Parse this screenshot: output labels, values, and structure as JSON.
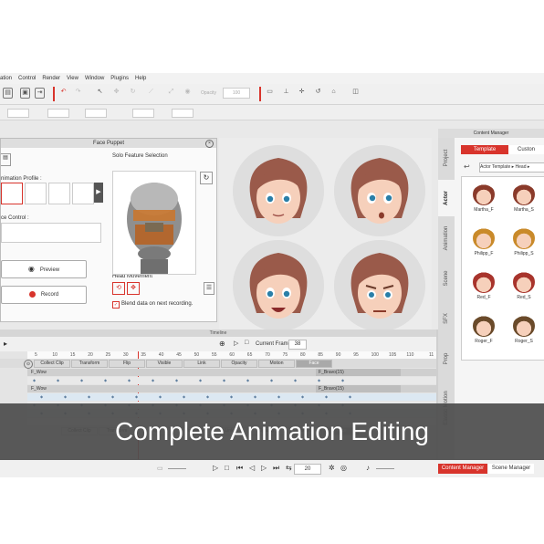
{
  "menu": {
    "items": [
      "ation",
      "Control",
      "Render",
      "View",
      "Window",
      "Plugins",
      "Help"
    ]
  },
  "toolbar": {
    "opacity_label": "Opacity",
    "opacity_value": "100"
  },
  "content_manager": {
    "title": "Content Manager",
    "template_tab": "Template",
    "custom_tab": "Custon",
    "breadcrumb": "Actor Template ▸ Head ▸",
    "side_tabs": [
      "Project",
      "Actor",
      "Animation",
      "Scene",
      "SFX",
      "Prop",
      "Elastic Motion"
    ],
    "thumbnails": [
      {
        "label": "Martha_F",
        "hair": "#8a3a2a"
      },
      {
        "label": "Martha_S",
        "hair": "#8a3a2a"
      },
      {
        "label": "Philipp_F",
        "hair": "#c98a2a"
      },
      {
        "label": "Philipp_S",
        "hair": "#c98a2a"
      },
      {
        "label": "Red_F",
        "hair": "#a8342c"
      },
      {
        "label": "Red_S",
        "hair": "#a8342c"
      },
      {
        "label": "Roger_F",
        "hair": "#6a4a2a"
      },
      {
        "label": "Roger_S",
        "hair": "#6a4a2a"
      }
    ]
  },
  "face_puppet": {
    "title": "Face Puppet",
    "animation_profile_label": "nimation Profile :",
    "face_control_label": "ce Control :",
    "solo_feature_label": "Solo Feature Selection",
    "preview_button": "Preview",
    "record_button": "Record",
    "head_movement_label": "Head Movement",
    "blend_checkbox_label": "Blend data on next recording."
  },
  "timeline": {
    "title": "Timeline",
    "current_frame_label": "Current Frame:",
    "current_frame_value": "38",
    "ruler_ticks": [
      "5",
      "10",
      "15",
      "20",
      "25",
      "30",
      "35",
      "40",
      "45",
      "50",
      "55",
      "60",
      "65",
      "70",
      "75",
      "80",
      "85",
      "90",
      "95",
      "100",
      "105",
      "110"
    ],
    "end_tick": "11",
    "track_buttons": [
      "Collect Clip",
      "Transform",
      "Flip",
      "Visible",
      "Link",
      "Opacity",
      "Motion",
      "Face"
    ],
    "clip_rows": [
      {
        "left": "F_Wow",
        "right": "F_Bravo(15)"
      },
      {
        "left": "F_Wow",
        "right": "F_Bravo(15)"
      }
    ],
    "lower_track_buttons": [
      "Collect Clip",
      "Transform",
      "Flip",
      "Visible",
      "Link",
      "Opacity",
      "Motion",
      "Face"
    ]
  },
  "playback": {
    "frame_value": "20"
  },
  "bottom_tabs": {
    "content_manager": "Content Manager",
    "scene_manager": "Scene Manager"
  },
  "banner": {
    "text": "Complete Animation Editing"
  },
  "colors": {
    "accent": "#d8342c",
    "banner": "#4e4e4e",
    "skin": "#f6d0bb",
    "hair": "#9a5a4a",
    "bg_circle": "#dedede"
  }
}
